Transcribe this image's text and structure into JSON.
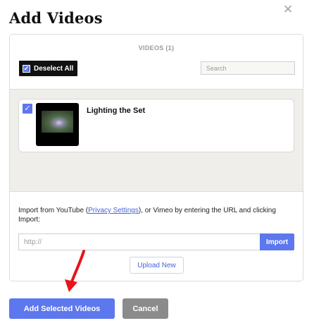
{
  "dialog": {
    "title": "Add Videos",
    "close_glyph": "×"
  },
  "library": {
    "count_label": "VIDEOS (1)",
    "deselect_label": "Deselect All",
    "search_placeholder": "Search"
  },
  "videos": [
    {
      "title": "Lighting the Set",
      "selected": true
    }
  ],
  "import": {
    "text_before": "Import from YouTube (",
    "link_label": "Privacy Settings",
    "text_after": "), or Vimeo by entering the URL and clicking Import:",
    "url_placeholder": "http://",
    "import_label": "Import",
    "upload_label": "Upload New"
  },
  "footer": {
    "add_label": "Add Selected Videos",
    "cancel_label": "Cancel"
  },
  "colors": {
    "accent": "#5d77ee",
    "annotation_arrow": "#e8141b",
    "cancel": "#8b8b8b"
  },
  "icons": {
    "close": "close-icon",
    "checkbox": "check-icon",
    "annotation": "red-arrow-icon"
  }
}
